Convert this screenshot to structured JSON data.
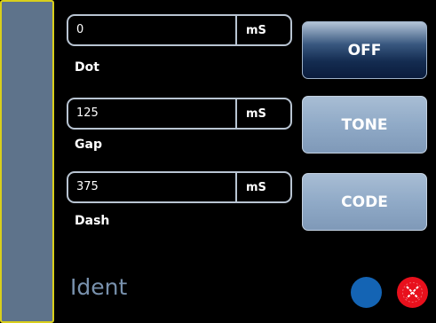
{
  "panel": {
    "title": "Ident"
  },
  "fields": [
    {
      "label": "Dot",
      "value": "0",
      "unit": "mS"
    },
    {
      "label": "Gap",
      "value": "125",
      "unit": "mS"
    },
    {
      "label": "Dash",
      "value": "375",
      "unit": "mS"
    }
  ],
  "buttons": [
    {
      "label": "OFF",
      "state": "selected"
    },
    {
      "label": "TONE",
      "state": "unselected"
    },
    {
      "label": "CODE",
      "state": "unselected"
    }
  ],
  "indicators": {
    "blue": {
      "icon": "blue-circle-icon",
      "color": "#1464b4"
    },
    "red": {
      "icon": "close-icon",
      "color": "#e8101c"
    }
  },
  "colors": {
    "accent_yellow": "#d9cf1c",
    "side_panel": "#5e738b",
    "title_text": "#7891ad"
  }
}
